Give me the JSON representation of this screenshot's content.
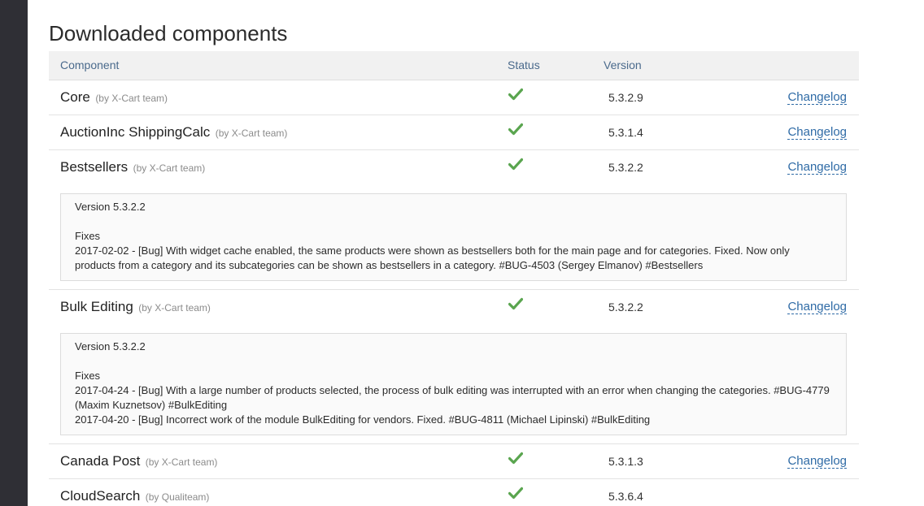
{
  "page_title": "Downloaded components",
  "table": {
    "headers": {
      "component": "Component",
      "status": "Status",
      "version": "Version"
    },
    "rows": [
      {
        "name": "Core",
        "author": "(by X-Cart team)",
        "version": "5.3.2.9",
        "changelog": "Changelog",
        "status_icon": "check-icon"
      },
      {
        "name": "AuctionInc ShippingCalc",
        "author": "(by X-Cart team)",
        "version": "5.3.1.4",
        "changelog": "Changelog",
        "status_icon": "check-icon"
      },
      {
        "name": "Bestsellers",
        "author": "(by X-Cart team)",
        "version": "5.3.2.2",
        "changelog": "Changelog",
        "status_icon": "check-icon",
        "log": {
          "version": "Version 5.3.2.2",
          "section": "Fixes",
          "entries": [
            "2017-02-02 - [Bug] With widget cache enabled, the same products were shown as bestsellers both for the main page and for categories. Fixed. Now only products from a category and its subcategories can be shown as bestsellers in a category. #BUG-4503 (Sergey Elmanov) #Bestsellers"
          ]
        }
      },
      {
        "name": "Bulk Editing",
        "author": "(by X-Cart team)",
        "version": "5.3.2.2",
        "changelog": "Changelog",
        "status_icon": "check-icon",
        "log": {
          "version": "Version 5.3.2.2",
          "section": "Fixes",
          "entries": [
            "2017-04-24 - [Bug] With a large number of products selected, the process of bulk editing was interrupted with an error when changing the categories. #BUG-4779 (Maxim Kuznetsov) #BulkEditing",
            "2017-04-20 - [Bug] Incorrect work of the module BulkEditing for vendors. Fixed. #BUG-4811 (Michael Lipinski) #BulkEditing"
          ]
        }
      },
      {
        "name": "Canada Post",
        "author": "(by X-Cart team)",
        "version": "5.3.1.3",
        "changelog": "Changelog",
        "status_icon": "check-icon"
      },
      {
        "name": "CloudSearch",
        "author": "(by Qualiteam)",
        "version": "5.3.6.4",
        "changelog": "",
        "status_icon": "check-icon"
      }
    ]
  },
  "colors": {
    "check": "#5aa54f",
    "link": "#2f6ba6",
    "header_text": "#4a6a8c"
  }
}
